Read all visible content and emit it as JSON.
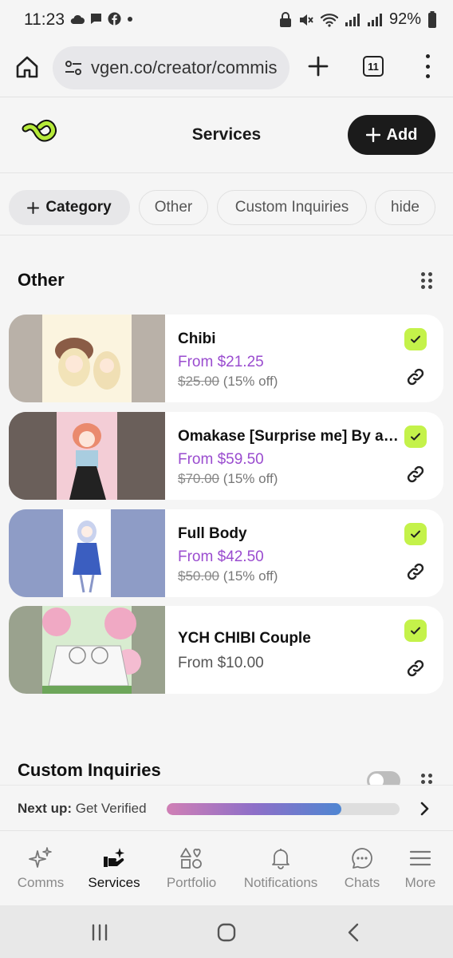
{
  "status_bar": {
    "time": "11:23",
    "battery": "92%"
  },
  "browser": {
    "url": "vgen.co/creator/commis",
    "tab_count": "11"
  },
  "header": {
    "title": "Services",
    "add_label": "Add"
  },
  "chips": [
    {
      "label": "Category",
      "active": true
    },
    {
      "label": "Other",
      "active": false
    },
    {
      "label": "Custom Inquiries",
      "active": false
    },
    {
      "label": "hide",
      "active": false
    }
  ],
  "sections": [
    {
      "title": "Other",
      "services": [
        {
          "name": "Chibi",
          "price": "From $21.25",
          "original_price": "$25.00",
          "discount": "(15% off)",
          "enabled": true
        },
        {
          "name": "Omakase [Surprise me] By ar...",
          "price": "From $59.50",
          "original_price": "$70.00",
          "discount": "(15% off)",
          "enabled": true
        },
        {
          "name": "Full Body",
          "price": "From $42.50",
          "original_price": "$50.00",
          "discount": "(15% off)",
          "enabled": true
        },
        {
          "name": "YCH CHIBI Couple",
          "price": "From $10.00",
          "enabled": true
        }
      ]
    },
    {
      "title": "Custom Inquiries"
    }
  ],
  "next_up": {
    "label": "Next up:",
    "value": "Get Verified",
    "progress": 0.75
  },
  "bottom_nav": [
    {
      "label": "Comms",
      "icon": "sparkles-icon",
      "active": false
    },
    {
      "label": "Services",
      "icon": "services-hand-icon",
      "active": true
    },
    {
      "label": "Portfolio",
      "icon": "shapes-icon",
      "active": false
    },
    {
      "label": "Notifications",
      "icon": "bell-icon",
      "active": false
    },
    {
      "label": "Chats",
      "icon": "chat-bubble-icon",
      "active": false
    },
    {
      "label": "More",
      "icon": "hamburger-icon",
      "active": false
    }
  ],
  "colors": {
    "accent_purple": "#9a4ccf",
    "check_green": "#c4f24a",
    "brand_green": "#b6ea3a"
  }
}
